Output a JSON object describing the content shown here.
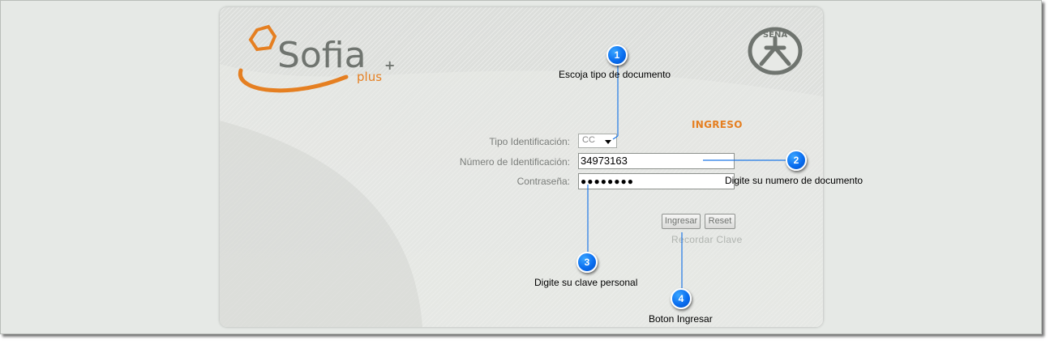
{
  "logo": {
    "name": "Sofia",
    "suffix": "plus"
  },
  "partner_logo": {
    "text": "SENA"
  },
  "form": {
    "heading": "INGRESO",
    "tipo_label": "Tipo Identificación:",
    "tipo_value": "CC",
    "numero_label": "Número de Identificación:",
    "numero_value": "34973163",
    "password_label": "Contraseña:",
    "password_value": "●●●●●●●●",
    "login_button": "Ingresar",
    "reset_button": "Reset",
    "recover_link": "Recordar Clave"
  },
  "callouts": [
    {
      "number": "1",
      "text": "Escoja tipo de documento"
    },
    {
      "number": "2",
      "text": "Digite su numero de documento"
    },
    {
      "number": "3",
      "text": "Digite su clave personal"
    },
    {
      "number": "4",
      "text": "Boton Ingresar"
    }
  ],
  "colors": {
    "accent": "#e57f21",
    "logo_gray": "#6f746f",
    "bubble": "#0a6ef0",
    "connector": "#1e78e6",
    "frame_bg": "#e6e9e6"
  }
}
